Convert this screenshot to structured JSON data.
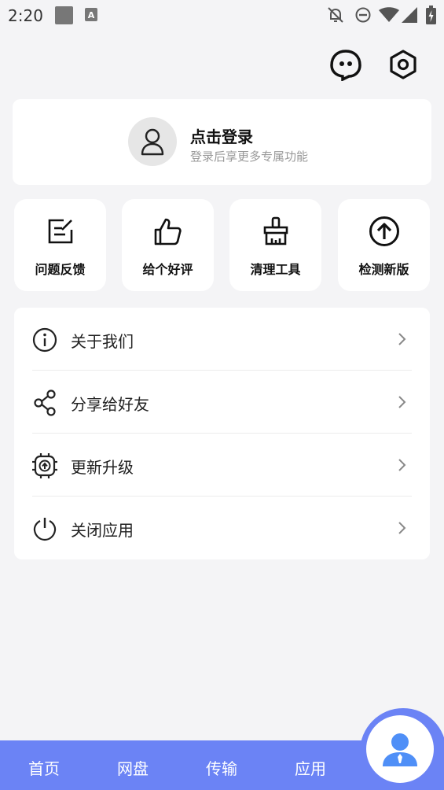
{
  "status_bar": {
    "time": "2:20",
    "icons": [
      "gallery-icon",
      "app-a-icon",
      "bell-off-icon",
      "do-not-disturb-icon",
      "wifi-icon",
      "signal-icon",
      "battery-icon"
    ]
  },
  "header": {
    "actions": [
      "chat-bot-icon",
      "settings-hexagon-icon"
    ]
  },
  "login": {
    "title": "点击登录",
    "subtitle": "登录后享更多专属功能"
  },
  "quick_actions": [
    {
      "label": "问题反馈",
      "icon": "feedback-icon"
    },
    {
      "label": "给个好评",
      "icon": "thumbs-up-icon"
    },
    {
      "label": "清理工具",
      "icon": "brush-icon"
    },
    {
      "label": "检测新版",
      "icon": "arrow-up-circle-icon"
    }
  ],
  "menu": [
    {
      "label": "关于我们",
      "icon": "info-icon"
    },
    {
      "label": "分享给好友",
      "icon": "share-icon"
    },
    {
      "label": "更新升级",
      "icon": "update-icon"
    },
    {
      "label": "关闭应用",
      "icon": "power-icon"
    }
  ],
  "bottom_nav": {
    "tabs": [
      "首页",
      "网盘",
      "传输",
      "应用"
    ],
    "active_icon": "profile-icon"
  },
  "colors": {
    "accent": "#6b83f5",
    "background": "#f4f4f6",
    "card": "#ffffff"
  }
}
